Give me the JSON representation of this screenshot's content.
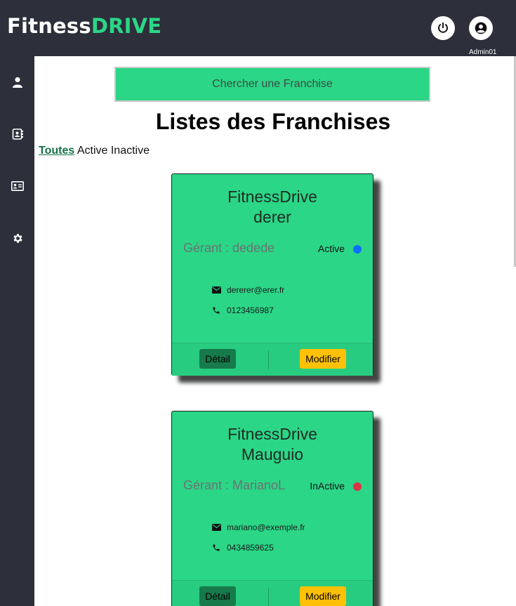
{
  "header": {
    "logo_part1": "Fitness",
    "logo_part2": "DRIVE",
    "user_label": "Admin01"
  },
  "sidebar": {
    "items": [
      {
        "icon": "user-icon"
      },
      {
        "icon": "address-book-icon"
      },
      {
        "icon": "id-card-icon"
      },
      {
        "icon": "gear-icon"
      }
    ]
  },
  "main": {
    "search_button": "Chercher une Franchise",
    "title": "Listes des Franchises",
    "filters": [
      "Toutes",
      "Active",
      "Inactive"
    ]
  },
  "cards": [
    {
      "name_line1": "FitnessDrive",
      "name_line2": "derer",
      "manager": "Gérant : dedede",
      "status": "Active",
      "status_color": "#0d6efd",
      "email": "dererer@erer.fr",
      "phone": "0123456987",
      "detail_label": "Détail",
      "edit_label": "Modifier"
    },
    {
      "name_line1": "FitnessDrive",
      "name_line2": "Mauguio",
      "manager": "Gérant : MarianoL",
      "status": "InActive",
      "status_color": "#dc3545",
      "email": "mariano@exemple.fr",
      "phone": "0434859625",
      "detail_label": "Détail",
      "edit_label": "Modifier"
    }
  ],
  "colors": {
    "brand_green": "#2bd687",
    "dark_bg": "#2d2f3a",
    "active_blue": "#0d6efd",
    "inactive_red": "#dc3545",
    "edit_yellow": "#ffc107"
  }
}
